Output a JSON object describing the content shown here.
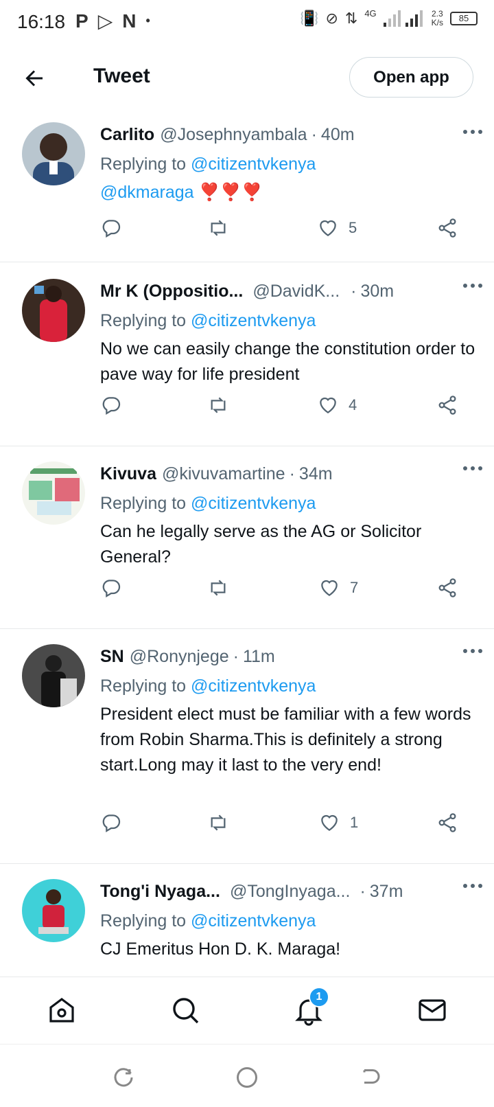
{
  "status_bar": {
    "time": "16:18",
    "left_icons": [
      "P",
      "▷",
      "N",
      "•"
    ],
    "network": "4G",
    "speed_top": "2.3",
    "speed_bottom": "K/s",
    "battery": "85"
  },
  "header": {
    "title": "Tweet",
    "open_app_label": "Open app"
  },
  "tweets": [
    {
      "name": "Carlito",
      "handle": "@Josephnyambala",
      "time": "40m",
      "replying_prefix": "Replying to",
      "replying_to": "@citizentvkenya",
      "text_mention": "@dkmaraga",
      "text": " ❣️❣️❣️",
      "replies": "",
      "retweets": "",
      "likes": "5",
      "avatar_color": "#4a6a8a"
    },
    {
      "name": "Mr K (Oppositio...",
      "handle": "@DavidK...",
      "time": "30m",
      "replying_prefix": "Replying to",
      "replying_to": "@citizentvkenya",
      "text": "No we can easily change the constitution order to pave way for life president",
      "likes": "4",
      "avatar_color": "#6b2a2a"
    },
    {
      "name": "Kivuva",
      "handle": "@kivuvamartine",
      "time": "34m",
      "replying_prefix": "Replying to",
      "replying_to": "@citizentvkenya",
      "text": "Can he legally serve as the AG or Solicitor General?",
      "likes": "7",
      "avatar_color": "#e8eee0"
    },
    {
      "name": "SN",
      "handle": "@Ronynjege",
      "time": "11m",
      "replying_prefix": "Replying to",
      "replying_to": "@citizentvkenya",
      "text": "President elect must be familiar with a few words from Robin Sharma.This is definitely a strong start.Long may it last to the very end!",
      "likes": "1",
      "avatar_color": "#2a2a2a"
    },
    {
      "name": "Tong'i Nyaga...",
      "handle": "@TongInyaga...",
      "time": "37m",
      "replying_prefix": "Replying to",
      "replying_to": "@citizentvkenya",
      "text": "CJ Emeritus Hon D. K. Maraga!",
      "avatar_color": "#3fd0d8"
    }
  ],
  "bottom_nav": {
    "items": [
      "home-icon",
      "search-icon",
      "notifications-icon",
      "messages-icon"
    ],
    "notification_badge": "1"
  },
  "colors": {
    "accent": "#1d9bf0",
    "text": "#0f1419",
    "secondary": "#536471",
    "divider": "#e7e9ea"
  }
}
